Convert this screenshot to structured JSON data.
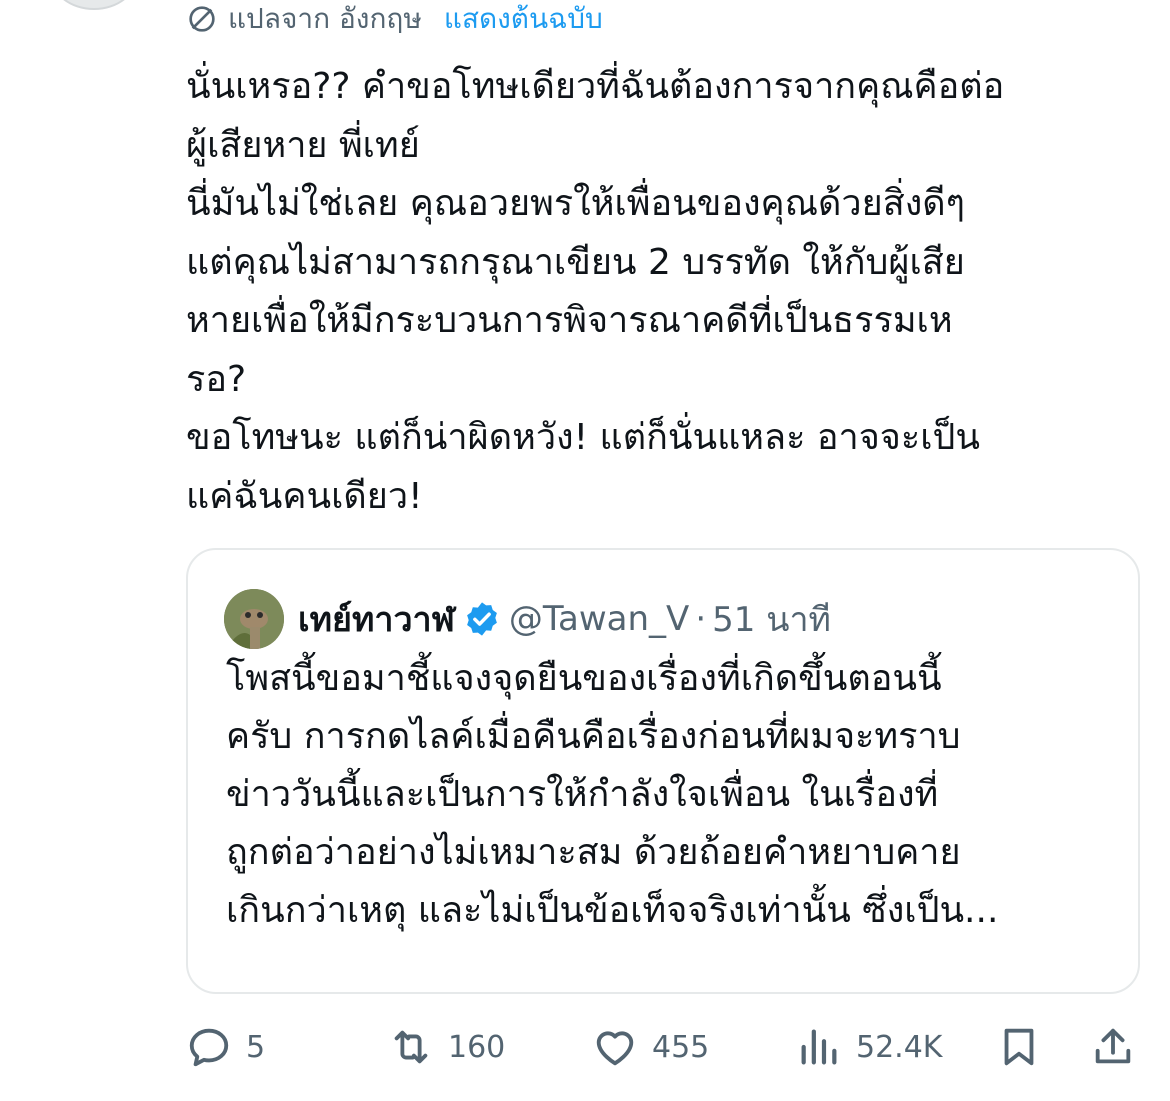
{
  "translation_bar": {
    "label": "แปลจาก อังกฤษ",
    "show_original": "แสดงต้นฉบับ"
  },
  "tweet": {
    "text": "นั่นเหรอ?? คำขอโทษเดียวที่ฉันต้องการจากคุณคือต่อ\nผู้เสียหาย พี่เทย์\nนี่มันไม่ใช่เลย คุณอวยพรให้เพื่อนของคุณด้วยสิ่งดีๆ\nแต่คุณไม่สามารถกรุณาเขียน 2 บรรทัด ให้กับผู้เสีย\nหายเพื่อให้มีกระบวนการพิจารณาคดีที่เป็นธรรมเห\nรอ?\nขอโทษนะ แต่ก็น่าผิดหวัง! แต่ก็นั่นแหละ อาจจะเป็น\nแค่ฉันคนเดียว!"
  },
  "quoted_tweet": {
    "display_name": "เทย์ทาวาฬ",
    "handle": "@Tawan_V",
    "separator": "·",
    "time": "51 นาที",
    "text": "โพสนี้ขอมาชี้แจงจุดยืนของเรื่องที่เกิดขึ้นตอนนี้\nครับ การกดไลค์เมื่อคืนคือเรื่องก่อนที่ผมจะทราบ\nข่าววันนี้และเป็นการให้กำลังใจเพื่อน ในเรื่องที่\nถูกต่อว่าอย่างไม่เหมาะสม ด้วยถ้อยคำหยาบคาย\nเกินกว่าเหตุ และไม่เป็นข้อเท็จจริงเท่านั้น ซึ่งเป็น..."
  },
  "actions": {
    "replies": "5",
    "reposts": "160",
    "likes": "455",
    "views": "52.4K"
  },
  "icons": [
    "translate-icon",
    "verified-badge-icon",
    "reply-icon",
    "repost-icon",
    "like-icon",
    "views-icon",
    "bookmark-icon",
    "share-icon"
  ],
  "colors": {
    "link": "#1d9bf0",
    "text": "#0f1419",
    "muted": "#536471",
    "border": "#e6e9ea"
  }
}
